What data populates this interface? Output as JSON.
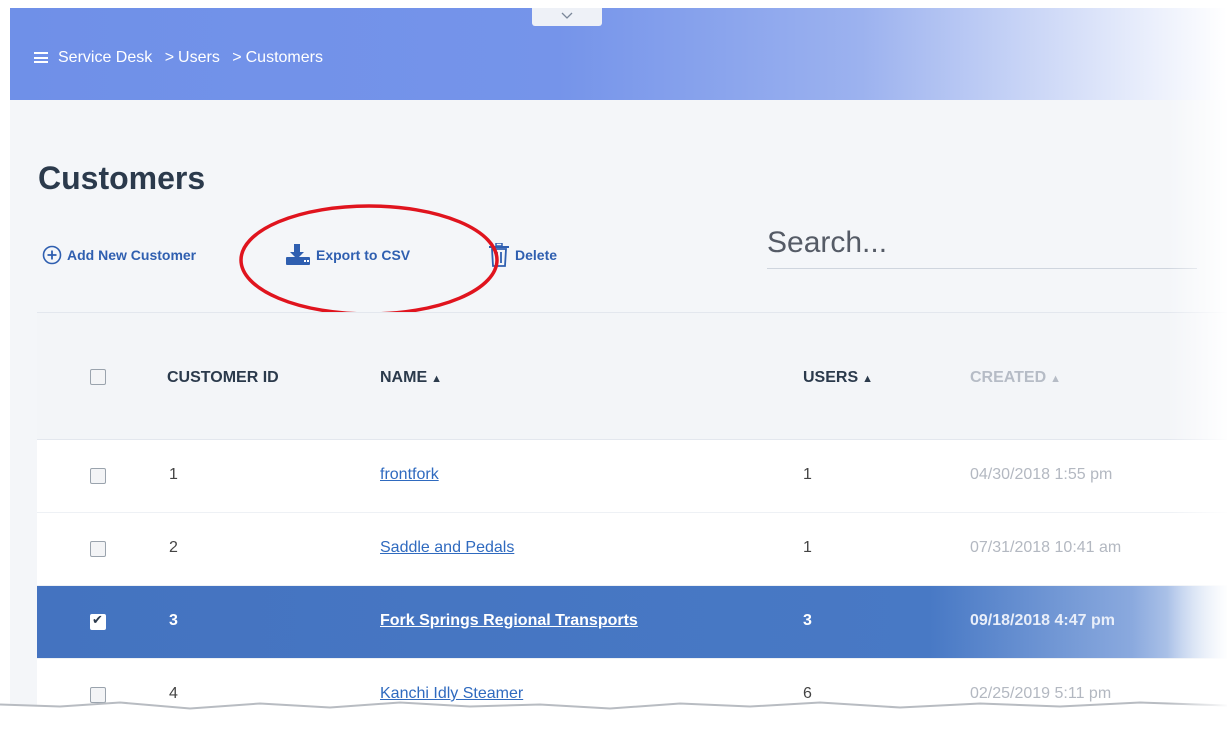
{
  "header": {
    "breadcrumb": [
      "Service Desk",
      "Users",
      "Customers"
    ],
    "separator": ">"
  },
  "page": {
    "title": "Customers"
  },
  "toolbar": {
    "add_label": "Add New Customer",
    "export_label": "Export to CSV",
    "delete_label": "Delete"
  },
  "search": {
    "placeholder": "Search..."
  },
  "table": {
    "columns": {
      "customer_id": "CUSTOMER ID",
      "name": "NAME",
      "users": "USERS",
      "created": "CREATED"
    },
    "rows": [
      {
        "id": "1",
        "name": "frontfork",
        "users": "1",
        "created": "04/30/2018 1:55 pm",
        "checked": false
      },
      {
        "id": "2",
        "name": "Saddle and Pedals",
        "users": "1",
        "created": "07/31/2018 10:41 am",
        "checked": false
      },
      {
        "id": "3",
        "name": "Fork Springs Regional Transports",
        "users": "3",
        "created": "09/18/2018 4:47 pm",
        "checked": true
      },
      {
        "id": "4",
        "name": "Kanchi Idly Steamer",
        "users": "6",
        "created": "02/25/2019 5:11 pm",
        "checked": false
      }
    ]
  },
  "colors": {
    "header_blue": "#6f90e8",
    "link_blue": "#2f6abf",
    "selected_row": "#4473c0",
    "annotation_red": "#e0141e"
  },
  "icons": {
    "menu": "hamburger-icon",
    "add": "plus-circle-icon",
    "export": "download-icon",
    "delete": "trash-icon",
    "handle": "chevron-down-icon"
  }
}
